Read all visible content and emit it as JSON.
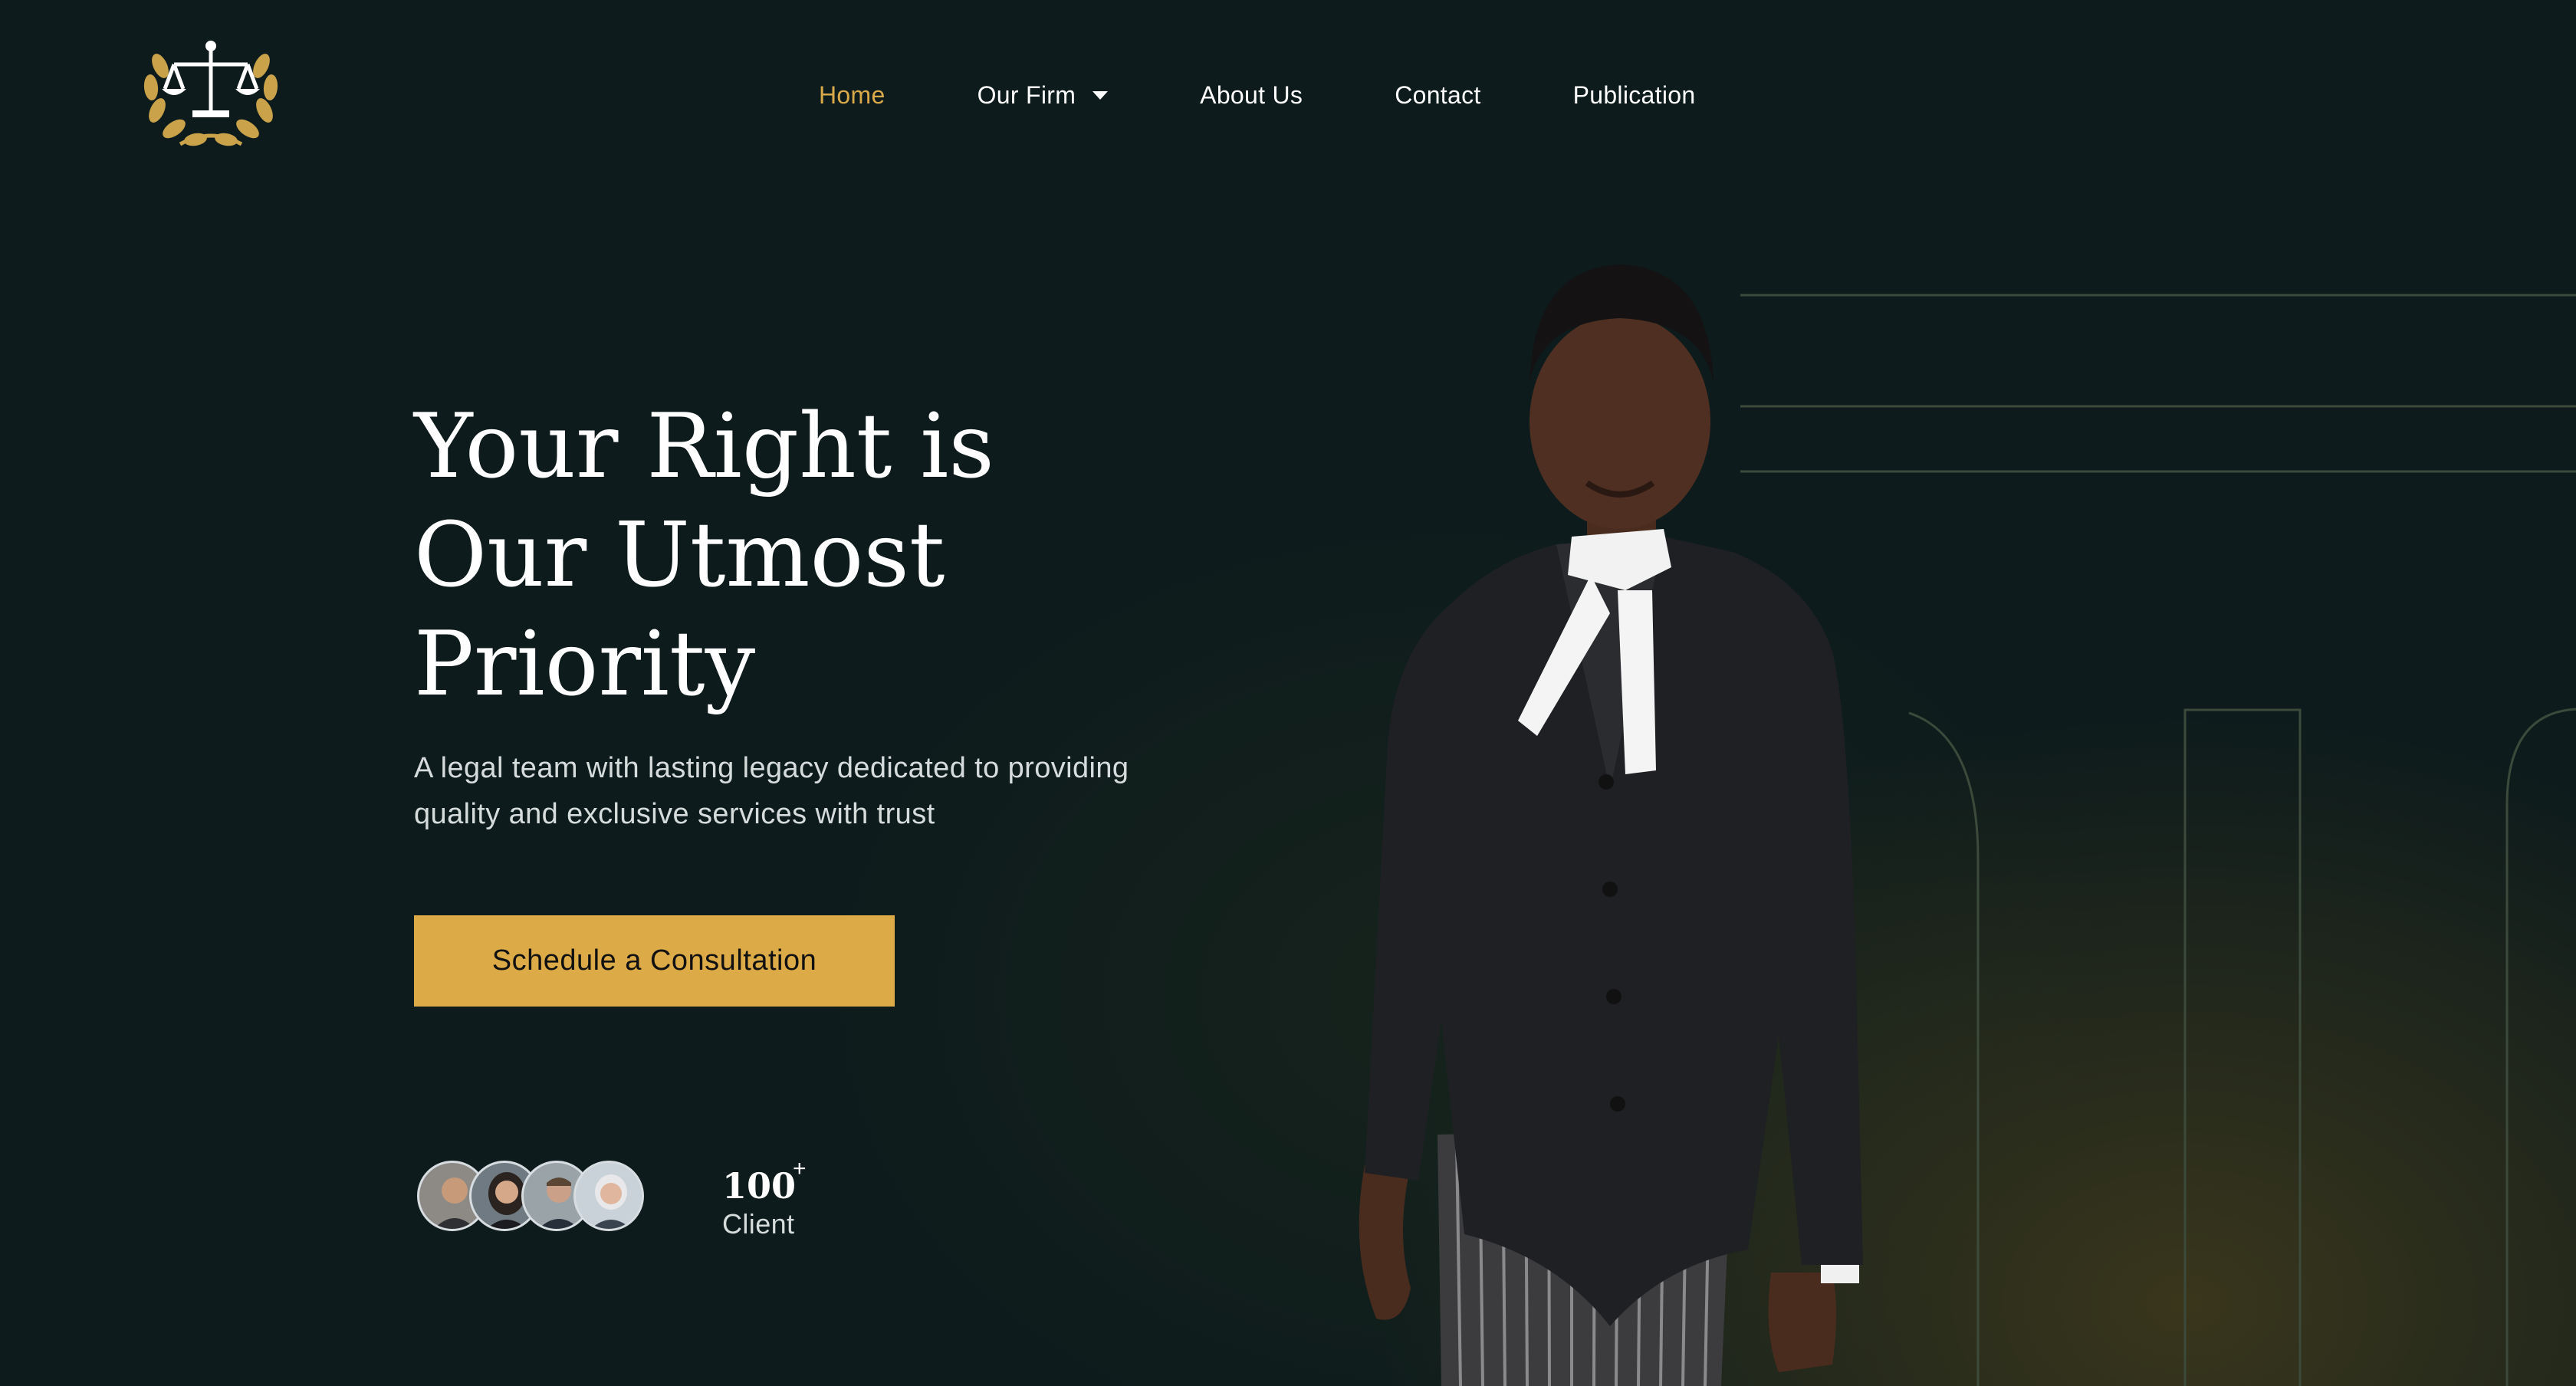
{
  "brand": {
    "logo_icon": "scales-of-justice-laurel-icon",
    "accent": "#dcab48"
  },
  "nav": {
    "items": [
      {
        "label": "Home",
        "active": true
      },
      {
        "label": "Our Firm",
        "dropdown": true
      },
      {
        "label": "About Us"
      },
      {
        "label": "Contact"
      },
      {
        "label": "Publication"
      }
    ]
  },
  "hero": {
    "title_lines": [
      "Your Right is",
      "Our Utmost",
      "Priority"
    ],
    "subtitle_lines": [
      "A legal team with lasting legacy dedicated to providing",
      "quality and exclusive services with trust"
    ],
    "cta_label": "Schedule a Consultation"
  },
  "stats": {
    "value": "100",
    "suffix": "+",
    "label": "Client"
  },
  "colors": {
    "background": "#0d1b1c",
    "active_nav": "#d9a94a",
    "cta": "#dcab48"
  }
}
